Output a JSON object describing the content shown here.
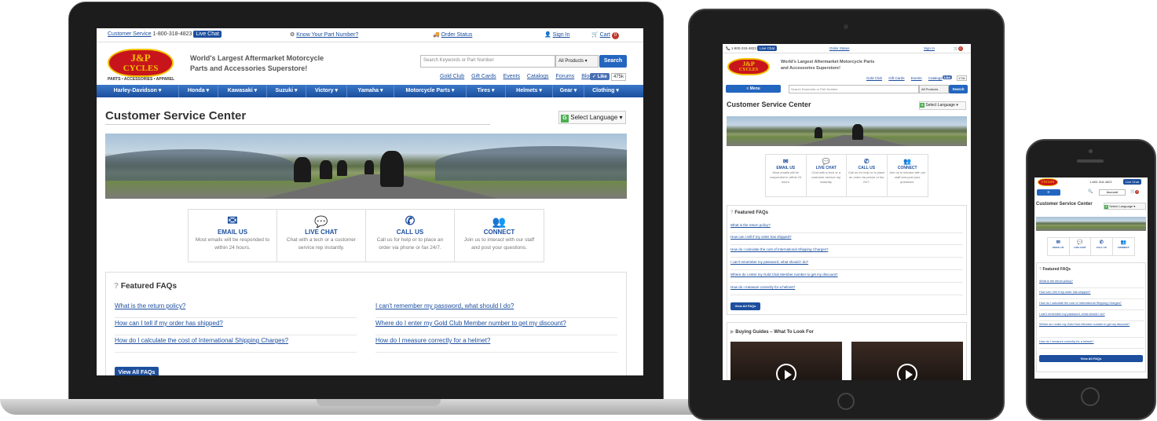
{
  "util": {
    "customer_service": "Customer Service",
    "phone": "1-800-318-4823",
    "live_chat": "Live Chat",
    "part_number": "Know Your Part Number?",
    "order_status": "Order Status",
    "sign_in": "Sign In",
    "cart": "Cart",
    "cart_count": "0"
  },
  "brand": {
    "logo_line1": "J&P",
    "logo_line2": "CYCLES",
    "logo_sub": "PARTS • ACCESSORIES • APPAREL",
    "tagline_line1": "World's Largest Aftermarket Motorcycle",
    "tagline_line2": "Parts and Accessories Superstore!",
    "tablet_tagline_line1": "World's Largest Aftermarket Motorcycle Parts",
    "tablet_tagline_line2": "and Accessories Superstore!"
  },
  "search": {
    "placeholder": "Search Keywords or Part Number",
    "category": "All Products",
    "button": "Search"
  },
  "header_links": [
    "Gold Club",
    "Gift Cards",
    "Events",
    "Catalogs",
    "Forums",
    "Blog"
  ],
  "like": {
    "label": "Like",
    "count": "475k"
  },
  "nav": [
    "Harley-Davidson",
    "Honda",
    "Kawasaki",
    "Suzuki",
    "Victory",
    "Yamaha",
    "Motorcycle Parts",
    "Tires",
    "Helmets",
    "Gear",
    "Clothing"
  ],
  "page": {
    "title": "Customer Service Center",
    "select_language": "Select Language"
  },
  "contact": [
    {
      "title": "EMAIL US",
      "desc": "Most emails will be responded to within 24 hours.",
      "icon": "envelope-icon"
    },
    {
      "title": "LIVE CHAT",
      "desc": "Chat with a tech or a customer service rep instantly.",
      "icon": "chat-bubbles-icon"
    },
    {
      "title": "CALL US",
      "desc": "Call us for help or to place an order via phone or fax 24/7.",
      "icon": "phone-icon"
    },
    {
      "title": "CONNECT",
      "desc": "Join us to interact with our staff and post your questions.",
      "icon": "people-icon"
    }
  ],
  "faq": {
    "heading": "Featured FAQs",
    "items": [
      "What is the return policy?",
      "How can I tell if my order has shipped?",
      "How do I calculate the cost of International Shipping Charges?",
      "I can't remember my password, what should I do?",
      "Where do I enter my Gold Club Member number to get my discount?",
      "How do I measure correctly for a helmet?"
    ],
    "view_all": "View All FAQs"
  },
  "tablet": {
    "menu": "Menu",
    "buying_guides": "Buying Guides – What To Look For"
  },
  "phone": {
    "account": "Account",
    "menu_glyph": "≡"
  }
}
